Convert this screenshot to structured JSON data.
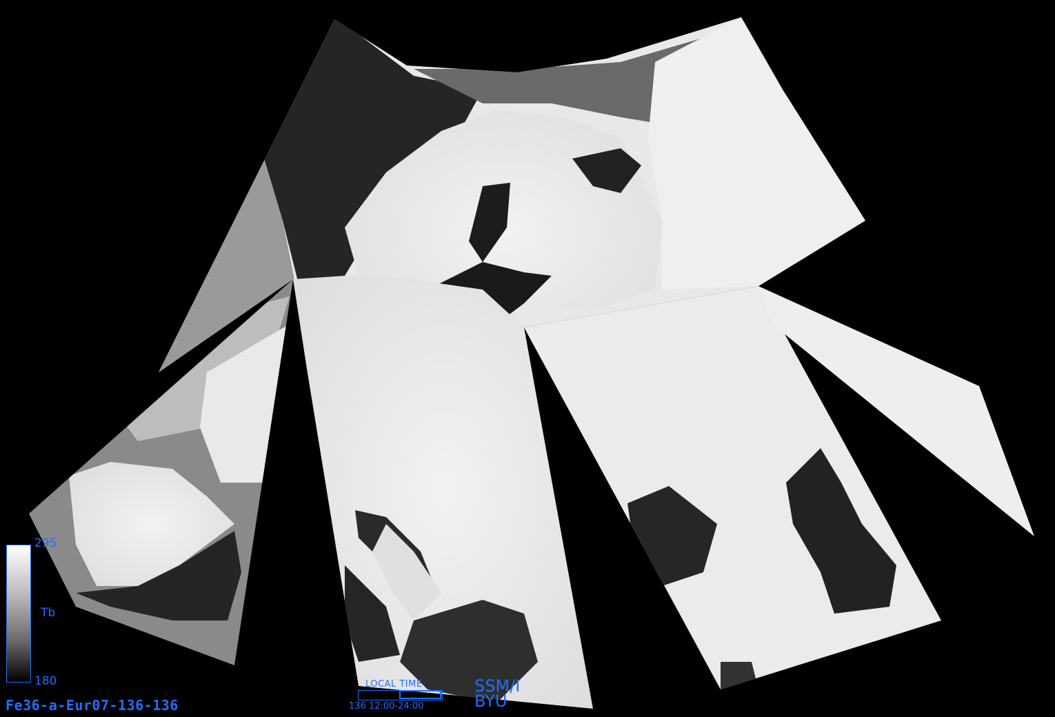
{
  "image": {
    "palette": {
      "ocean": "#2a2a2a",
      "land": "#ececec",
      "background": "#000000",
      "annotation": "#1e6fff"
    }
  },
  "colorbar": {
    "max_label": "295",
    "min_label": "180",
    "unit_label": "Tb",
    "colors": [
      "#ffffff",
      "#bdbdbd",
      "#6a6a6a",
      "#000000"
    ]
  },
  "file_id": "Fe36-a-Eur07-136-136",
  "local_time": {
    "title": "LOCAL  TIME",
    "range": "136  12:00-24:00"
  },
  "sensor": {
    "name": "SSM/I",
    "org": "BYU"
  }
}
